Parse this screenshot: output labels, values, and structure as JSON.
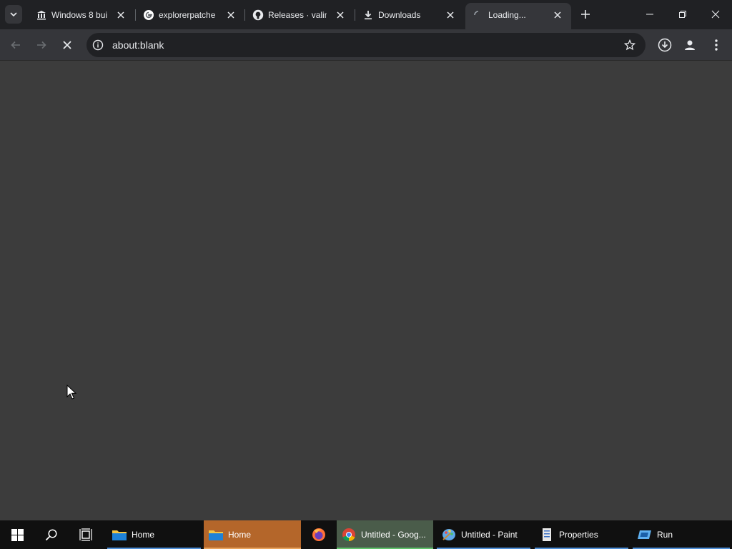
{
  "browser": {
    "tabs": [
      {
        "title": "Windows 8 bui",
        "icon": "bank-icon",
        "active": false
      },
      {
        "title": "explorerpatche",
        "icon": "google-icon",
        "active": false
      },
      {
        "title": "Releases · valin",
        "icon": "github-icon",
        "active": false
      },
      {
        "title": "Downloads",
        "icon": "download-icon",
        "active": false
      },
      {
        "title": "Loading...",
        "icon": "spinner-icon",
        "active": true
      }
    ],
    "address": "about:blank",
    "colors": {
      "tabstrip": "#202124",
      "toolbar": "#35363a",
      "omnibox": "#202124",
      "content": "#3c3c3c",
      "text": "#e8eaed"
    }
  },
  "taskbar": {
    "items": [
      {
        "label": "Home",
        "icon": "folder-icon",
        "bg": "#101010",
        "indicator": "#4f8fd6"
      },
      {
        "label": "Home",
        "icon": "folder-icon",
        "bg": "#b4662a",
        "indicator": "#e9a35d"
      },
      {
        "label": "",
        "icon": "firefox-icon",
        "bg": "#101010",
        "indicator": ""
      },
      {
        "label": "Untitled - Goog...",
        "icon": "chrome-icon",
        "bg": "#4a5c4a",
        "indicator": "#5fc26a"
      },
      {
        "label": "Untitled - Paint",
        "icon": "paint-icon",
        "bg": "#101010",
        "indicator": "#4f8fd6"
      },
      {
        "label": "Properties",
        "icon": "properties-icon",
        "bg": "#101010",
        "indicator": "#4f8fd6"
      },
      {
        "label": "Run",
        "icon": "run-icon",
        "bg": "#101010",
        "indicator": "#4f8fd6"
      }
    ],
    "colors": {
      "background": "#101010",
      "text": "#ffffff"
    }
  }
}
